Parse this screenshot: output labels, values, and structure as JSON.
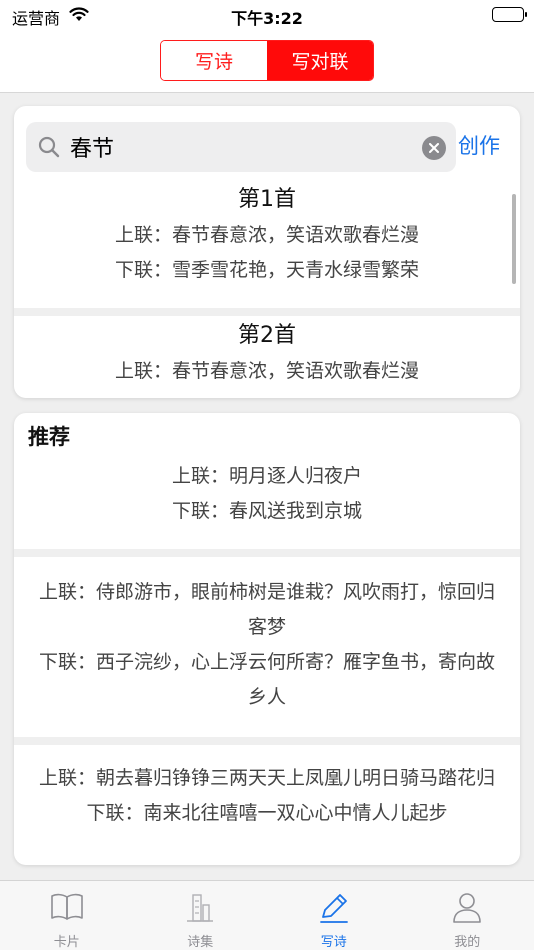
{
  "status": {
    "carrier": "运营商",
    "time": "下午3:22"
  },
  "segmented": {
    "poem": "写诗",
    "couplet": "写对联"
  },
  "search": {
    "value": "春节",
    "create_label": "创作"
  },
  "results": [
    {
      "title": "第1首",
      "upper": "上联：春节春意浓，笑语欢歌春烂漫",
      "lower": "下联：雪季雪花艳，天青水绿雪繁荣"
    },
    {
      "title": "第2首",
      "upper": "上联：春节春意浓，笑语欢歌春烂漫"
    }
  ],
  "recommend": {
    "title": "推荐",
    "items": [
      {
        "upper": "上联：明月逐人归夜户",
        "lower": "下联：春风送我到京城"
      },
      {
        "upper": "上联：侍郎游市，眼前柿树是谁栽？风吹雨打，惊回归客梦",
        "lower": "下联：西子浣纱，心上浮云何所寄？雁字鱼书，寄向故乡人"
      },
      {
        "upper": "上联：朝去暮归铮铮三两天天上凤凰儿明日骑马踏花归",
        "lower": "下联：南来北往嘻嘻一双心心中情人儿起步"
      }
    ]
  },
  "tabbar": {
    "items": [
      {
        "label": "卡片",
        "icon": "book-icon"
      },
      {
        "label": "诗集",
        "icon": "pavilion-icon"
      },
      {
        "label": "写诗",
        "icon": "pencil-icon"
      },
      {
        "label": "我的",
        "icon": "person-icon"
      }
    ],
    "active_color": "#1a73e8",
    "inactive_color": "#8e8e93"
  },
  "colors": {
    "accent_red": "#ff0a0a",
    "link_blue": "#1a73e8"
  }
}
